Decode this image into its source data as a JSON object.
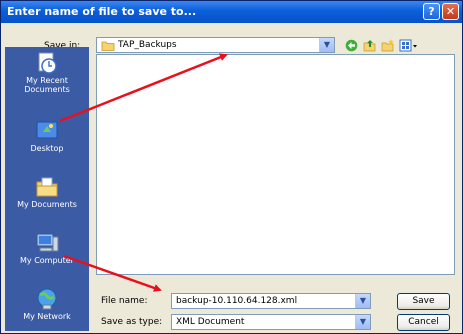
{
  "dialog": {
    "title": "Enter name of file to save to...",
    "help_glyph": "?",
    "close_glyph": "✕"
  },
  "toolbar": {
    "save_in_label": "Save in:",
    "folder": "TAP_Backups",
    "dropdown_glyph": "▼",
    "icons": [
      "back-icon",
      "up-folder-icon",
      "new-folder-icon",
      "views-menu-icon"
    ]
  },
  "places": [
    {
      "label": "My Recent Documents",
      "icon": "recent-documents-icon"
    },
    {
      "label": "Desktop",
      "icon": "desktop-icon"
    },
    {
      "label": "My Documents",
      "icon": "my-documents-icon"
    },
    {
      "label": "My Computer",
      "icon": "my-computer-icon"
    },
    {
      "label": "My Network",
      "icon": "my-network-icon"
    }
  ],
  "form": {
    "file_name_label": "File name:",
    "file_name_value": "backup-10.110.64.128.xml",
    "save_as_type_label": "Save as type:",
    "save_as_type_value": "XML Document"
  },
  "buttons": {
    "save": "Save",
    "cancel": "Cancel"
  },
  "colors": {
    "title_bar": "#0753c9",
    "places_bar": "#3b5ba5",
    "annotation_arrow": "#e8101c"
  }
}
